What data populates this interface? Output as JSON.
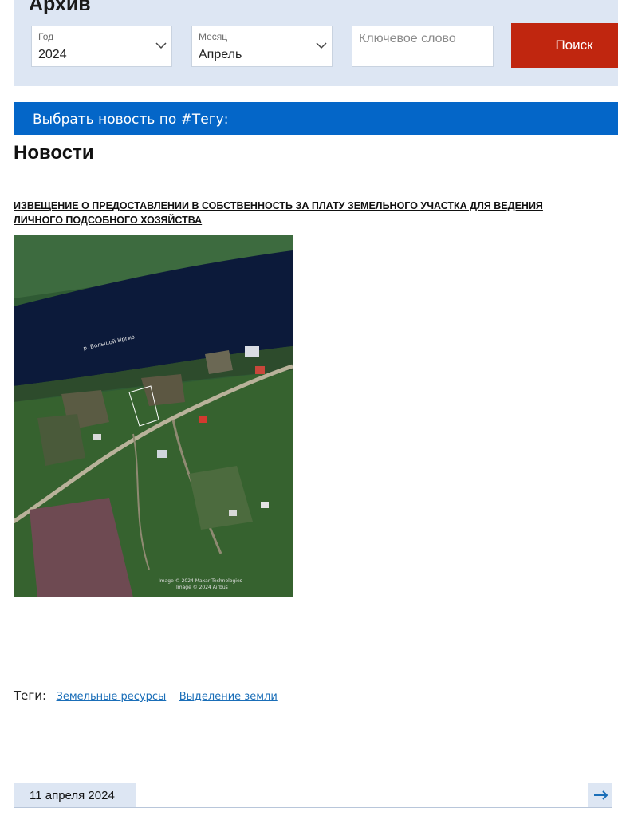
{
  "archive": {
    "title": "Архив",
    "year": {
      "label": "Год",
      "value": "2024"
    },
    "month": {
      "label": "Месяц",
      "value": "Апрель"
    },
    "keyword": {
      "placeholder": "Ключевое слово",
      "value": ""
    },
    "search_label": "Поиск"
  },
  "tag_bar": {
    "label": "Выбрать новость по #Тегу:"
  },
  "section_title": "Новости",
  "news": {
    "title": "ИЗВЕЩЕНИЕ О ПРЕДОСТАВЛЕНИИ В СОБСТВЕННОСТЬ ЗА ПЛАТУ ЗЕМЕЛЬНОГО УЧАСТКА ДЛЯ ВЕДЕНИЯ ЛИЧНОГО ПОДСОБНОГО ХОЗЯЙСТВА",
    "image": {
      "river_label": "р. Большой Иргиз",
      "credit_line_1": "Image © 2024 Maxar Technologies",
      "credit_line_2": "Image © 2024 Airbus"
    },
    "tags_label": "Теги:",
    "tags": [
      "Земельные ресурсы",
      "Выделение земли"
    ],
    "date": "11 апреля 2024"
  },
  "colors": {
    "panel_bg": "#dde6f3",
    "search_button": "#c0260f",
    "tag_bar": "#0466c8",
    "tag_link": "#1a6eb8"
  },
  "icons": {
    "select_chevron": "chevron-down-icon",
    "next": "arrow-right-icon"
  }
}
